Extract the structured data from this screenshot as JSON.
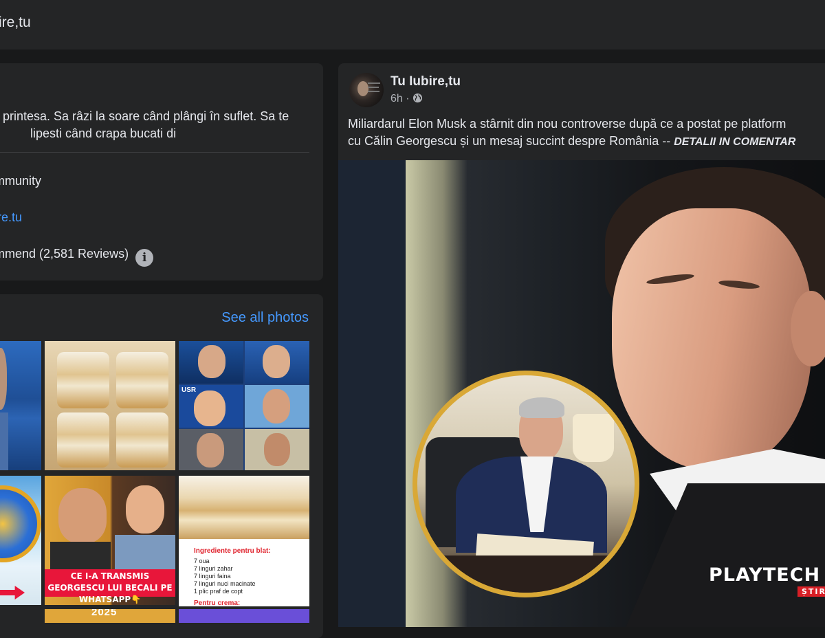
{
  "header": {
    "page_name": "ire,tu"
  },
  "intro": {
    "bio_line1": "printesa. Sa râzi la soare când plângi în suflet. Sa te",
    "bio_line2": "lipesti când crapa bucati di",
    "category": "mmunity",
    "link": "ire.tu",
    "reviews": "mmend (2,581 Reviews)",
    "info_icon": "i"
  },
  "photos": {
    "see_all": "See all photos",
    "tile_captions": {
      "georgescu_becali": "CE I-A TRANSMIS GEORGESCU LUI BECALI PE WHATSAPP👇",
      "year": "2025"
    },
    "recipe": {
      "heading": "Ingrediente pentru blat:",
      "items": [
        "7 oua",
        "7 linguri zahar",
        "7 linguri faina",
        "7 linguri nuci macinate",
        "1 plic praf de copt"
      ],
      "next_heading": "Pentru crema:"
    },
    "usr_label": "USR"
  },
  "post": {
    "author": "Tu Iubire,tu",
    "time": "6h · ",
    "audience_icon": "globe-icon",
    "text_line1": "Miliardarul Elon Musk a stârnit din nou controverse după ce a postat pe platform",
    "text_line2": "cu Călin Georgescu și un mesaj succint despre România -- ",
    "text_cta": "DETALII IN COMENTAR",
    "watermark": "PLAYTECH",
    "watermark_sub": "ȘTIRI"
  },
  "colors": {
    "bg": "#18191a",
    "card": "#242526",
    "link": "#4599ff",
    "text": "#e4e6eb",
    "muted": "#b0b3b8",
    "gold_ring": "#d9a836",
    "red_banner": "#e8163a"
  }
}
